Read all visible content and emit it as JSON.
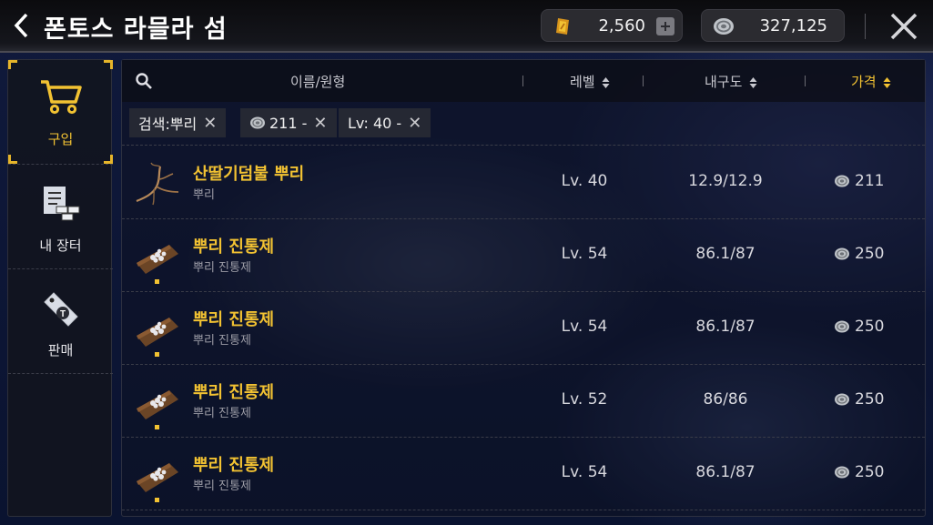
{
  "header": {
    "title": "폰토스 라믈라 섬",
    "currency_1": {
      "icon": "gold-ticket-icon",
      "value": "2,560"
    },
    "currency_2": {
      "icon": "silver-coin-icon",
      "value": "327,125"
    }
  },
  "sidebar": {
    "items": [
      {
        "label": "구입",
        "icon": "cart-icon",
        "active": true
      },
      {
        "label": "내 장터",
        "icon": "stall-icon",
        "active": false
      },
      {
        "label": "판매",
        "icon": "price-tag-icon",
        "active": false
      }
    ]
  },
  "table": {
    "columns": {
      "name": "이름/원형",
      "level": "레벨",
      "durability": "내구도",
      "price": "가격"
    },
    "filters": [
      {
        "label": "검색:뿌리"
      },
      {
        "label": "211 -",
        "icon": "silver-coin-icon"
      },
      {
        "label": "Lv: 40 -"
      }
    ],
    "rows": [
      {
        "name": "산딸기덤불 뿌리",
        "sub": "뿌리",
        "level": "Lv. 40",
        "durability": "12.9/12.9",
        "price": "211",
        "icon": "root-icon"
      },
      {
        "name": "뿌리 진통제",
        "sub": "뿌리 진통제",
        "level": "Lv. 54",
        "durability": "86.1/87",
        "price": "250",
        "icon": "plank-icon"
      },
      {
        "name": "뿌리 진통제",
        "sub": "뿌리 진통제",
        "level": "Lv. 54",
        "durability": "86.1/87",
        "price": "250",
        "icon": "plank-icon"
      },
      {
        "name": "뿌리 진통제",
        "sub": "뿌리 진통제",
        "level": "Lv. 52",
        "durability": "86/86",
        "price": "250",
        "icon": "plank-icon"
      },
      {
        "name": "뿌리 진통제",
        "sub": "뿌리 진통제",
        "level": "Lv. 54",
        "durability": "86.1/87",
        "price": "250",
        "icon": "plank-icon"
      }
    ]
  },
  "colors": {
    "accent": "#f2c232",
    "background": "#0d1636"
  }
}
